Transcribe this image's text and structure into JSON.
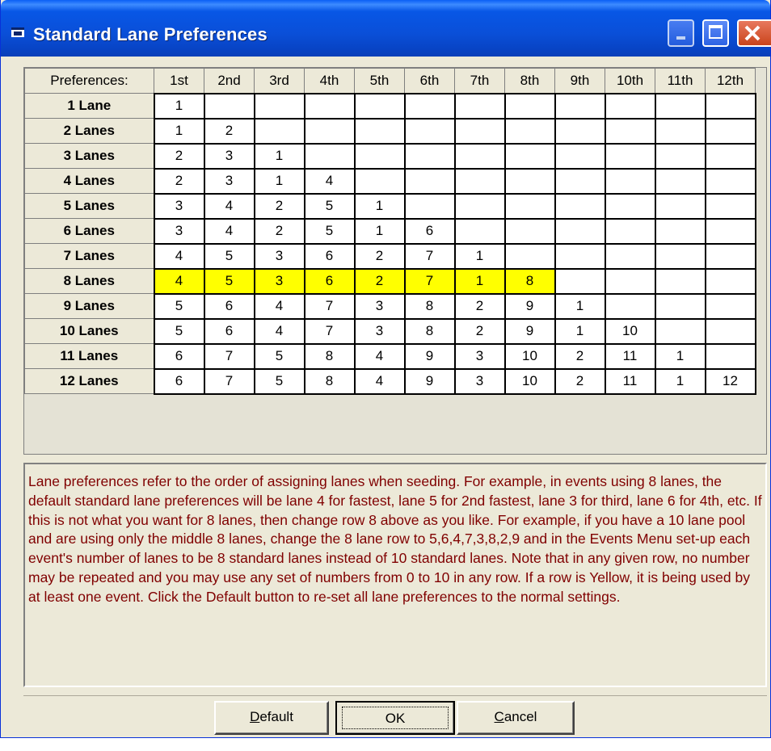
{
  "window": {
    "title": "Standard Lane Preferences"
  },
  "grid": {
    "corner_label": "Preferences:",
    "columns": [
      "1st",
      "2nd",
      "3rd",
      "4th",
      "5th",
      "6th",
      "7th",
      "8th",
      "9th",
      "10th",
      "11th",
      "12th"
    ],
    "highlight_color": "#ffff00",
    "rows": [
      {
        "label": "1 Lane",
        "highlighted": false,
        "values": [
          "1",
          "",
          "",
          "",
          "",
          "",
          "",
          "",
          "",
          "",
          "",
          ""
        ]
      },
      {
        "label": "2 Lanes",
        "highlighted": false,
        "values": [
          "1",
          "2",
          "",
          "",
          "",
          "",
          "",
          "",
          "",
          "",
          "",
          ""
        ]
      },
      {
        "label": "3 Lanes",
        "highlighted": false,
        "values": [
          "2",
          "3",
          "1",
          "",
          "",
          "",
          "",
          "",
          "",
          "",
          "",
          ""
        ]
      },
      {
        "label": "4 Lanes",
        "highlighted": false,
        "values": [
          "2",
          "3",
          "1",
          "4",
          "",
          "",
          "",
          "",
          "",
          "",
          "",
          ""
        ]
      },
      {
        "label": "5 Lanes",
        "highlighted": false,
        "values": [
          "3",
          "4",
          "2",
          "5",
          "1",
          "",
          "",
          "",
          "",
          "",
          "",
          ""
        ]
      },
      {
        "label": "6 Lanes",
        "highlighted": false,
        "values": [
          "3",
          "4",
          "2",
          "5",
          "1",
          "6",
          "",
          "",
          "",
          "",
          "",
          ""
        ]
      },
      {
        "label": "7 Lanes",
        "highlighted": false,
        "values": [
          "4",
          "5",
          "3",
          "6",
          "2",
          "7",
          "1",
          "",
          "",
          "",
          "",
          ""
        ]
      },
      {
        "label": "8 Lanes",
        "highlighted": true,
        "values": [
          "4",
          "5",
          "3",
          "6",
          "2",
          "7",
          "1",
          "8",
          "",
          "",
          "",
          ""
        ]
      },
      {
        "label": "9 Lanes",
        "highlighted": false,
        "values": [
          "5",
          "6",
          "4",
          "7",
          "3",
          "8",
          "2",
          "9",
          "1",
          "",
          "",
          ""
        ]
      },
      {
        "label": "10 Lanes",
        "highlighted": false,
        "values": [
          "5",
          "6",
          "4",
          "7",
          "3",
          "8",
          "2",
          "9",
          "1",
          "10",
          "",
          ""
        ]
      },
      {
        "label": "11 Lanes",
        "highlighted": false,
        "values": [
          "6",
          "7",
          "5",
          "8",
          "4",
          "9",
          "3",
          "10",
          "2",
          "11",
          "1",
          ""
        ]
      },
      {
        "label": "12 Lanes",
        "highlighted": false,
        "values": [
          "6",
          "7",
          "5",
          "8",
          "4",
          "9",
          "3",
          "10",
          "2",
          "11",
          "1",
          "12"
        ]
      }
    ]
  },
  "description": "Lane preferences refer to the order of assigning lanes when seeding.  For example, in events using 8 lanes, the default standard lane preferences will be lane 4 for fastest, lane 5 for 2nd fastest, lane 3 for third, lane 6 for 4th, etc.  If this is not what you want for 8 lanes, then change row 8 above as you like.  For example, if you have a 10 lane pool and are using only the middle 8 lanes, change the 8 lane row to 5,6,4,7,3,8,2,9 and in the Events Menu set-up each event's number of lanes to be 8 standard lanes instead of 10 standard lanes.  Note that in any given row, no number may be repeated and you may use any set of numbers from 0 to 10 in any row.  If a row is Yellow, it is being used by at least one event.  Click the Default button to re-set all lane preferences to the normal settings.",
  "description_color": "#800000",
  "buttons": {
    "default_accel": "D",
    "default_rest": "efault",
    "ok": "OK",
    "cancel_accel": "C",
    "cancel_rest": "ancel"
  }
}
